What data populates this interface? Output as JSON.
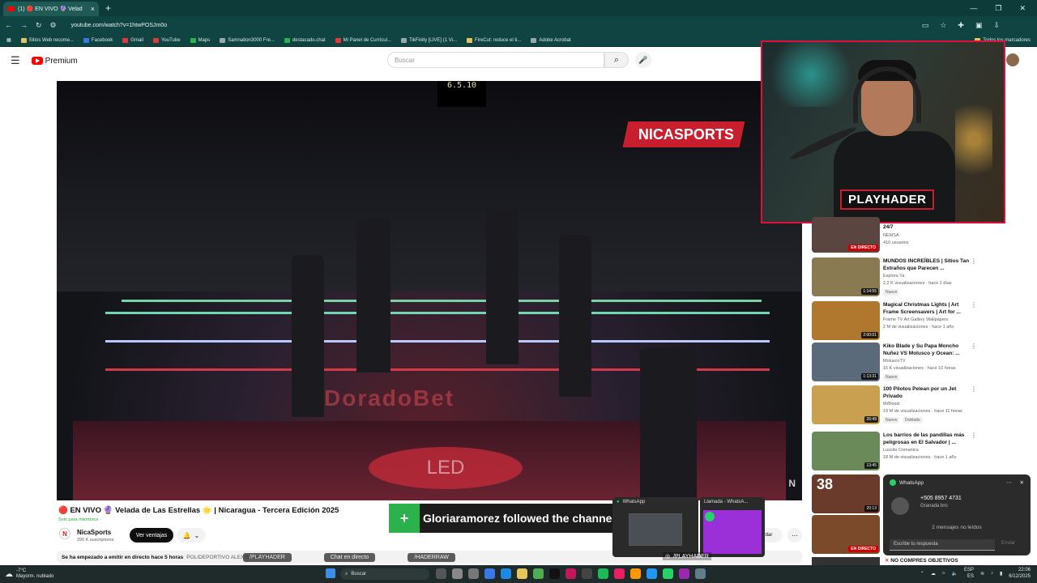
{
  "browser": {
    "tab_title": "(1) 🔴 EN VIVO 🔮 Velad",
    "url": "youtube.com/watch?v=1htwPOSJm0o",
    "bookmarks": [
      "Sitios Web recome...",
      "Facebook",
      "Gmail",
      "YouTube",
      "Maps",
      "Samnation3000 Fre...",
      "destacado.chat",
      "Mi Panel de Currícul...",
      "TikFinity [LIVE] (1 Vi...",
      "FireCut: reduce el ti...",
      "Adobe Acrobat"
    ],
    "bookmarks_right": "Todos los marcadores"
  },
  "youtube": {
    "logo": "Premium",
    "search_placeholder": "Buscar"
  },
  "video": {
    "overlay_brand": "NICASPORTS",
    "floor_brand": "DoradoBet",
    "scoreboard": "6.5.10",
    "watermark": "N"
  },
  "webcam": {
    "name_plate": "PLAYHADER"
  },
  "recommendations": [
    {
      "title": "24/7",
      "channel": "NEMSA",
      "meta": "410 usuarios",
      "live_label": "EN DIRECTO",
      "thumb_color": "#5a4540"
    },
    {
      "title": "MUNDOS INCREÍBLES | Sitios Tan Extraños que Parecen ...",
      "channel": "Explora Ya",
      "meta": "2,2 K visualizaciones · hace 2 días",
      "badge": "Nuevo",
      "duration": "1:14:55",
      "thumb_color": "#8a7a52"
    },
    {
      "title": "Magical Christmas Lights | Art Frame Screensavers | Art for ...",
      "channel": "Frame TV Art Gallery Wallpapers",
      "meta": "2 M de visualizaciones · hace 1 año",
      "duration": "2:00:01",
      "thumb_color": "#b0782e"
    },
    {
      "title": "Kiko Blade y Su Papa Moncho Nuñez VS Molusco y Ocean: ...",
      "channel": "MoluscoTV",
      "meta": "16 K visualizaciones · hace 10 horas",
      "badge": "Nuevo",
      "duration": "1:13:31",
      "thumb_color": "#5a6a7a"
    },
    {
      "title": "100 Pilotos Pelean por un Jet Privado",
      "channel": "MrBeast",
      "meta": "19 M de visualizaciones · hace 11 horas",
      "badge": "Nuevo",
      "badge2": "Doblado",
      "duration": "26:49",
      "thumb_color": "#c8a050"
    },
    {
      "title": "Los barrios de las pandillas más peligrosas en El Salvador | ...",
      "channel": "Lussito Comanica",
      "meta": "18 M de visualizaciones · hace 1 año",
      "duration": "13:45",
      "thumb_color": "#6a8a5a"
    },
    {
      "title": "",
      "channel": "",
      "meta": "",
      "duration": "20:13",
      "thumb_color": "#6a3a2a",
      "thumb_text": "38"
    },
    {
      "title": "",
      "channel": "",
      "meta": "",
      "live_label": "EN DIRECTO",
      "thumb_color": "#7a4a2a"
    }
  ],
  "rec_last_title": "NO COMPRES OBJETIVOS",
  "main_video": {
    "title": "🔴 EN VIVO 🔮 Velada de Las Estrellas 🌟 | Nicaragua - Tercera Edición 2025",
    "members_only": "Solo para miembros",
    "channel": "NicaSports",
    "channel_initial": "N",
    "subscribers": "290 K suscriptores",
    "join_label": "Ver ventajas",
    "save_label": "rdar",
    "desc_lead": "Se ha empezado a emitir en directo hace 5 horas",
    "desc_location": "POLIDEPORTIVO ALEXIS ARGÜELLO"
  },
  "stream_overlays": {
    "follow_text": "Gloriaramorez followed the channel!",
    "overlay_handle_1": "/PLAYHADER",
    "overlay_handle_2": "Chat en directo",
    "overlay_handle_3": "/HADERRAW",
    "instagram_handle": "/PLAYHADER"
  },
  "whatsapp": {
    "thumb_title": "WhatsApp",
    "call_title": "Llamada - WhatsA...",
    "popup_title": "WhatsApp",
    "contact_number": "+505 8957 4731",
    "contact_sub": "Granada bro",
    "unread": "2 mensajes no leídos",
    "reply_placeholder": "Escribe tu respuesta",
    "send_label": "Enviar"
  },
  "taskbar": {
    "temperature": "-7°C",
    "weather_desc": "Mayorm. nublado",
    "search_label": "Buscar",
    "lang_top": "ESP",
    "lang_bottom": "ES",
    "time": "22:06",
    "date": "6/12/2025"
  }
}
